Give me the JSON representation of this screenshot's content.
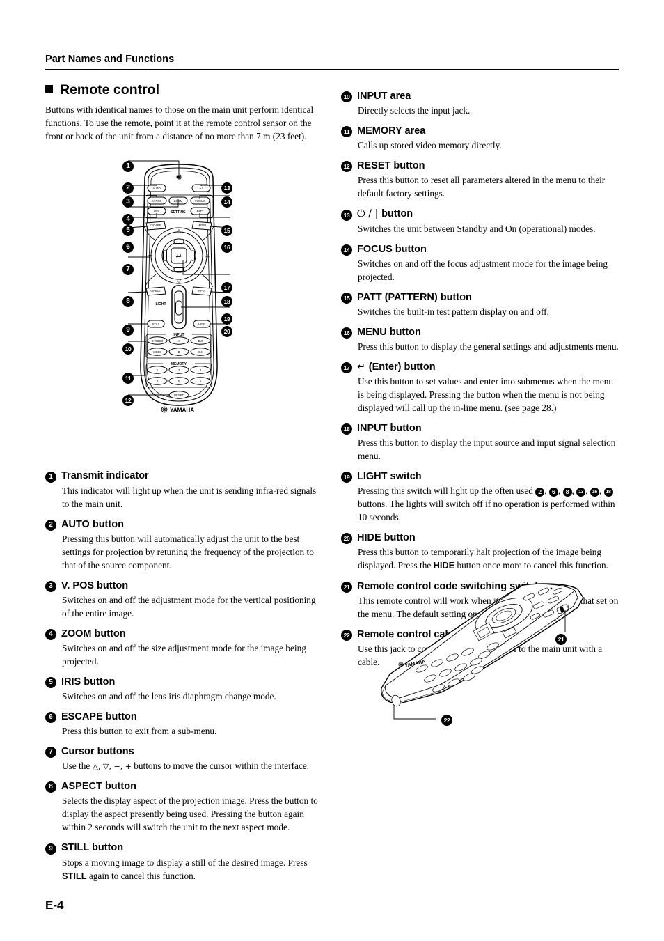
{
  "header": {
    "title": "Part Names and Functions"
  },
  "section": {
    "title": "Remote control",
    "intro": "Buttons with identical names to those on the main unit perform identical functions. To use the remote, point it at the remote control sensor on the front or back of the unit from a distance of no more than 7 m (23 feet)."
  },
  "left_items": [
    {
      "num": "1",
      "title": "Transmit indicator",
      "body": "This indicator will light up when the unit is sending infra-red signals to the main unit."
    },
    {
      "num": "2",
      "title": "AUTO button",
      "body": "Pressing this button will automatically adjust the unit to the best settings for projection by retuning the frequency of the projection to that of the source component."
    },
    {
      "num": "3",
      "title": "V. POS button",
      "body": "Switches on and off the adjustment mode for the vertical positioning of the entire image."
    },
    {
      "num": "4",
      "title": "ZOOM button",
      "body": "Switches on and off the size adjustment mode for the image being projected."
    },
    {
      "num": "5",
      "title": "IRIS button",
      "body": "Switches on and off the lens iris diaphragm change mode."
    },
    {
      "num": "6",
      "title": "ESCAPE button",
      "body": "Press this button to exit from a sub-menu."
    },
    {
      "num": "7",
      "title": "Cursor buttons",
      "body_pre": "Use the ",
      "body_sym": "△, ▽, −, +",
      "body_post": " buttons to move the cursor within the interface."
    },
    {
      "num": "8",
      "title": "ASPECT button",
      "body": "Selects the display aspect of the projection image. Press the button to display the aspect presently being used. Pressing the button again within 2 seconds will switch the unit to the next aspect mode."
    },
    {
      "num": "9",
      "title": "STILL button",
      "body_pre": "Stops a moving image to display a still of the desired image. Press ",
      "body_bold": "STILL",
      "body_post": " again to cancel this function."
    }
  ],
  "right_items": [
    {
      "num": "10",
      "title": "INPUT area",
      "body": "Directly selects the input jack."
    },
    {
      "num": "11",
      "title": "MEMORY area",
      "body": "Calls up stored video memory directly."
    },
    {
      "num": "12",
      "title": "RESET button",
      "body": "Press this button to reset all parameters altered in the menu to their default factory settings."
    },
    {
      "num": "13",
      "title_sym": "⏻ / |",
      "title": "button",
      "body": "Switches the unit between Standby and On (operational) modes."
    },
    {
      "num": "14",
      "title": "FOCUS button",
      "body": "Switches on and off the focus adjustment mode for the image being projected."
    },
    {
      "num": "15",
      "title": "PATT (PATTERN) button",
      "body": "Switches the built-in test pattern display on and off."
    },
    {
      "num": "16",
      "title": "MENU button",
      "body": "Press this button to display the general settings and adjustments menu."
    },
    {
      "num": "17",
      "title_sym": "↵",
      "title": "(Enter) button",
      "body": "Use this button to set values and enter into submenus when the menu is being displayed. Pressing the button when the menu is not being displayed will call up the in-line menu. (see page 28.)"
    },
    {
      "num": "18",
      "title": "INPUT button",
      "body": "Press this button to display the input source and input signal selection menu."
    },
    {
      "num": "19",
      "title": "LIGHT switch",
      "body_pre": "Pressing this switch will light up the often used ",
      "body_nums": [
        "2",
        "6",
        "8",
        "13",
        "16",
        "18"
      ],
      "body_post": " buttons. The lights will switch off if no operation is performed within 10 seconds."
    },
    {
      "num": "20",
      "title": "HIDE button",
      "body_pre": "Press this button to temporarily halt projection of the image being displayed. Press the ",
      "body_bold": "HIDE",
      "body_post": " button once more to cancel this function."
    },
    {
      "num": "21",
      "title": "Remote control code switching switch",
      "body": "This remote control will work when it has the same code as that set on the menu. The default setting on the menu is ID-1."
    },
    {
      "num": "22",
      "title": "Remote control cable jack",
      "body": "Use this jack to connect the remote control to the main unit with a cable."
    }
  ],
  "diagram": {
    "brand": "YAMAHA",
    "top_row": [
      "AUTO",
      "✦/I"
    ],
    "setting_group_label": "SETTING",
    "setting_buttons": [
      "V. POS",
      "ZOOM",
      "FOCUS",
      "IRIS",
      "PATT"
    ],
    "mid_buttons": [
      "ESCAPE",
      "MENU"
    ],
    "cursor_labels": [
      "△",
      "▽",
      "−",
      "+"
    ],
    "lower_buttons": [
      "ASPECT",
      "INPUT",
      "STILL",
      "HIDE"
    ],
    "light_label": "LIGHT",
    "input_group_label": "INPUT",
    "input_buttons": [
      "S VIDEO",
      "A",
      "DVI",
      "VIDEO",
      "B",
      "D4"
    ],
    "memory_group_label": "MEMORY",
    "memory_buttons": [
      "1",
      "2",
      "3",
      "4",
      "5",
      "6"
    ],
    "reset_button": "RESET",
    "callouts_left": [
      "1",
      "2",
      "3",
      "4",
      "5",
      "6",
      "7",
      "8",
      "9",
      "10",
      "11",
      "12"
    ],
    "callouts_right": [
      "13",
      "14",
      "15",
      "16",
      "17",
      "18",
      "19",
      "20"
    ],
    "side_callouts": [
      "21",
      "22"
    ]
  },
  "folio": {
    "page": "E-4"
  }
}
